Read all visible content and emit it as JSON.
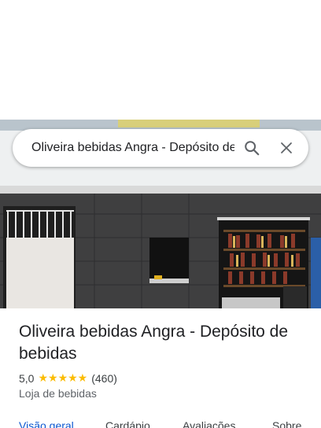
{
  "search": {
    "value": "Oliveira bebidas Angra - Depósito de"
  },
  "place": {
    "name": "Oliveira bebidas Angra - Depósito de bebidas",
    "rating": "5,0",
    "stars": "★★★★★",
    "review_count": "(460)",
    "category": "Loja de bebidas"
  },
  "tabs": [
    "Visão geral",
    "Cardápio",
    "Avaliações",
    "Sobre"
  ],
  "colors": {
    "accent": "#0b57d0",
    "star": "#fbbc04"
  },
  "icons": {
    "search": "search-icon",
    "close": "close-icon"
  }
}
